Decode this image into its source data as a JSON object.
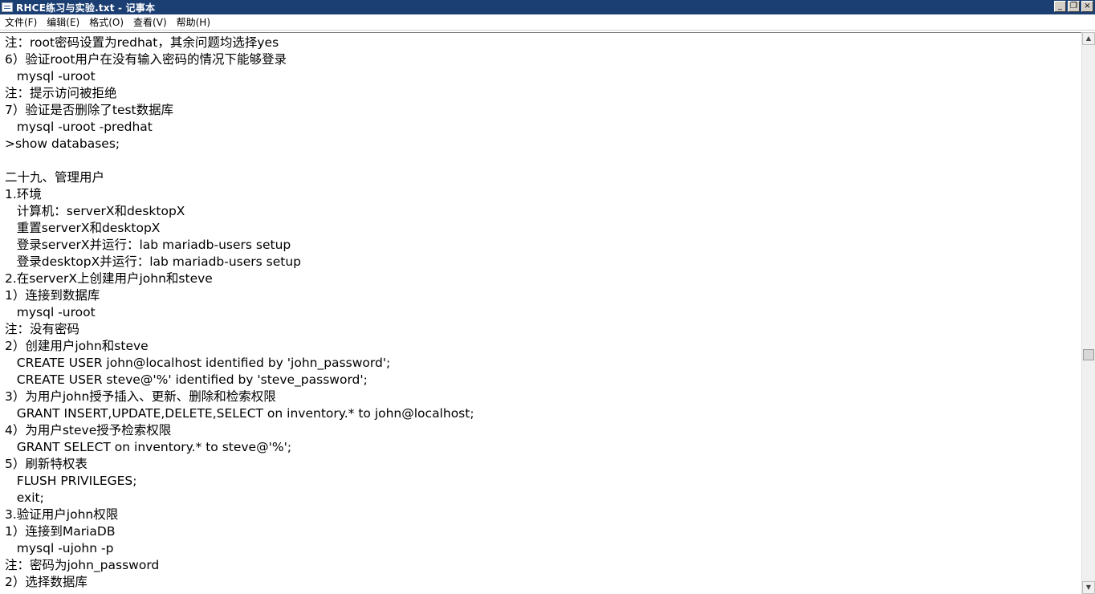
{
  "window": {
    "title": "RHCE练习与实验.txt - 记事本"
  },
  "titlebar_controls": {
    "minimize": "_",
    "restore": "❐",
    "close": "×"
  },
  "menu": {
    "items": [
      "文件(F)",
      "编辑(E)",
      "格式(O)",
      "查看(V)",
      "帮助(H)"
    ]
  },
  "document": {
    "lines": [
      "注：root密码设置为redhat，其余问题均选择yes",
      "6）验证root用户在没有输入密码的情况下能够登录",
      "   mysql -uroot",
      "注：提示访问被拒绝",
      "7）验证是否删除了test数据库",
      "   mysql -uroot -predhat",
      ">show databases;",
      "",
      "二十九、管理用户",
      "1.环境",
      "   计算机：serverX和desktopX",
      "   重置serverX和desktopX",
      "   登录serverX并运行：lab mariadb-users setup",
      "   登录desktopX并运行：lab mariadb-users setup",
      "2.在serverX上创建用户john和steve",
      "1）连接到数据库",
      "   mysql -uroot",
      "注：没有密码",
      "2）创建用户john和steve",
      "   CREATE USER john@localhost identified by 'john_password';",
      "   CREATE USER steve@'%' identified by 'steve_password';",
      "3）为用户john授予插入、更新、删除和检索权限",
      "   GRANT INSERT,UPDATE,DELETE,SELECT on inventory.* to john@localhost;",
      "4）为用户steve授予检索权限",
      "   GRANT SELECT on inventory.* to steve@'%';",
      "5）刷新特权表",
      "   FLUSH PRIVILEGES;",
      "   exit;",
      "3.验证用户john权限",
      "1）连接到MariaDB",
      "   mysql -ujohn -p",
      "注：密码为john_password",
      "2）选择数据库"
    ]
  },
  "scrollbar": {
    "up_arrow": "▲",
    "down_arrow": "▼"
  },
  "colors": {
    "titlebar_bg": "#1c3f73",
    "titlebar_text": "#ffffff",
    "editor_bg": "#ffffff",
    "text": "#000000"
  }
}
